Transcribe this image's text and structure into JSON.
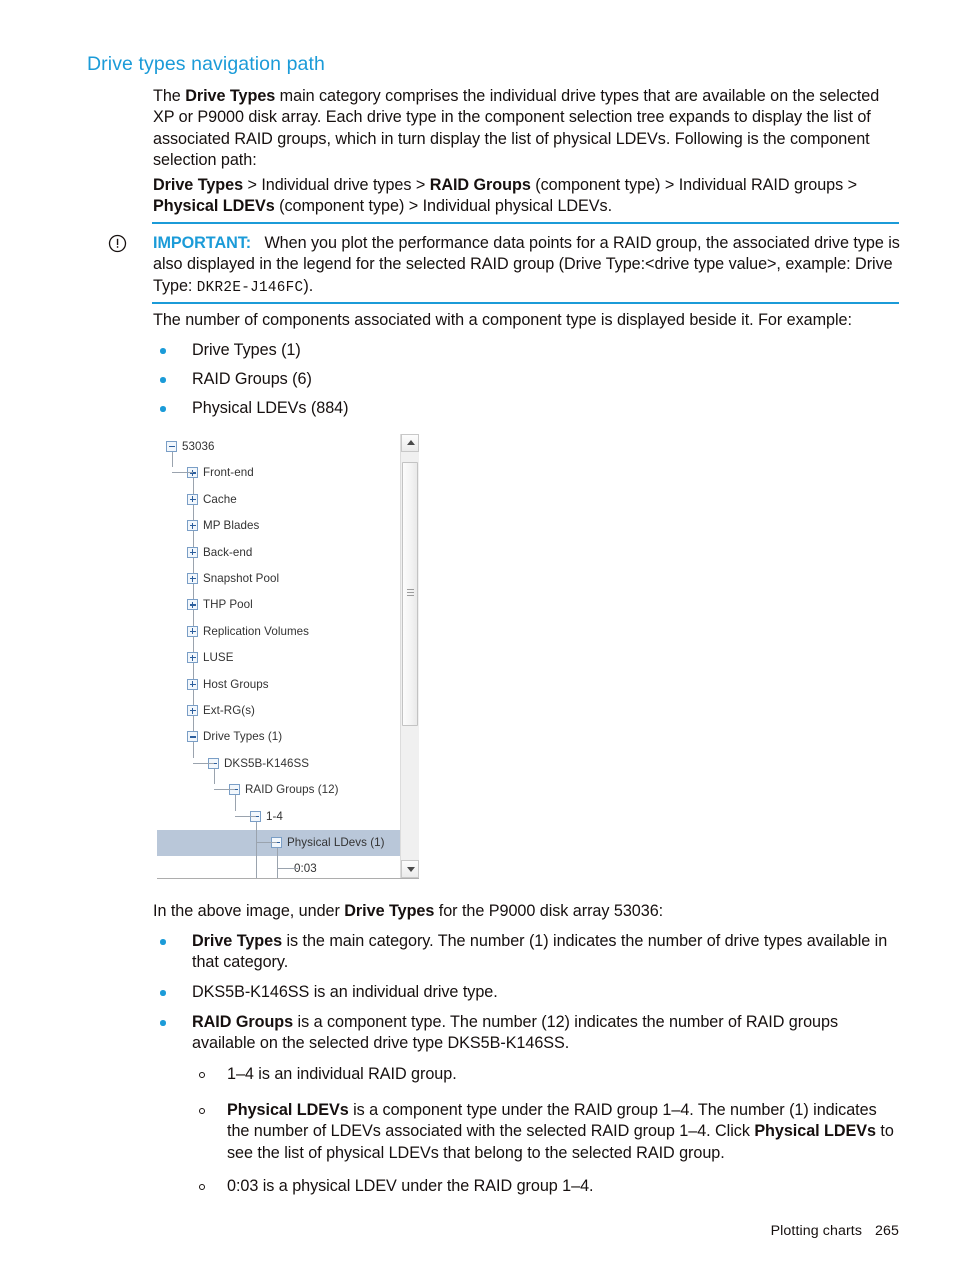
{
  "heading": "Drive types navigation path",
  "intro": {
    "line_prefix": "The ",
    "bold_1": "Drive Types",
    "rest": " main category comprises the individual drive types that are available on the selected XP or P9000 disk array. Each drive type in the component selection tree expands to display the list of associated RAID groups, which in turn display the list of physical LDEVs. Following is the component selection path:"
  },
  "path": {
    "seg1_bold": "Drive Types",
    "seg2": " > Individual drive types > ",
    "seg3_bold": "RAID Groups",
    "seg4": " (component type) > Individual RAID groups > ",
    "seg5_bold": "Physical LDEVs",
    "seg6": " (component type) > Individual physical LDEVs."
  },
  "important": {
    "icon": "exclamation-circle-icon",
    "label": "IMPORTANT:",
    "text_before_mono": "When you plot the performance data points for a RAID group, the associated drive type is also displayed in the legend for the selected RAID group (Drive Type:<drive type value>, example: Drive Type: ",
    "mono_value": "DKR2E-J146FC",
    "text_after_mono": ")."
  },
  "count_intro": "The number of components associated with a component type is displayed beside it. For example:",
  "count_bullets": [
    "Drive Types (1)",
    "RAID Groups (6)",
    "Physical LDEVs (884)"
  ],
  "tree": {
    "selected_row_index": 15,
    "rows": [
      {
        "label": "53036",
        "state": "minus",
        "depth": 0
      },
      {
        "label": "Front-end",
        "state": "plus",
        "depth": 1
      },
      {
        "label": "Cache",
        "state": "plus",
        "depth": 1
      },
      {
        "label": "MP Blades",
        "state": "plus",
        "depth": 1
      },
      {
        "label": "Back-end",
        "state": "plus",
        "depth": 1
      },
      {
        "label": "Snapshot Pool",
        "state": "plus",
        "depth": 1
      },
      {
        "label": "THP Pool",
        "state": "plus",
        "depth": 1
      },
      {
        "label": "Replication Volumes",
        "state": "plus",
        "depth": 1
      },
      {
        "label": "LUSE",
        "state": "plus",
        "depth": 1
      },
      {
        "label": "Host Groups",
        "state": "plus",
        "depth": 1
      },
      {
        "label": "Ext-RG(s)",
        "state": "plus",
        "depth": 1
      },
      {
        "label": "Drive Types (1)",
        "state": "minus",
        "depth": 1
      },
      {
        "label": "DKS5B-K146SS",
        "state": "minus",
        "depth": 2
      },
      {
        "label": "RAID Groups (12)",
        "state": "minus",
        "depth": 3
      },
      {
        "label": "1-4",
        "state": "minus",
        "depth": 4
      },
      {
        "label": "Physical LDevs (1)",
        "state": "minus",
        "depth": 5
      },
      {
        "label": "0:03",
        "state": "none",
        "depth": 6
      }
    ],
    "scrollbar": {
      "up_arrow": "scroll-up-arrow-icon",
      "down_arrow": "scroll-down-arrow-icon"
    }
  },
  "explain": {
    "intro_a": "In the above image, under ",
    "intro_bold": "Drive Types",
    "intro_b": " for the P9000 disk array 53036:",
    "b1_bold": "Drive Types",
    "b1_text": " is the main category. The number (1) indicates the number of drive types available in that category.",
    "b2_text": "DKS5B-K146SS is an individual drive type.",
    "b3_bold": "RAID Groups",
    "b3_text": " is a component type. The number (12) indicates the number of RAID groups available on the selected drive type DKS5B-K146SS.",
    "s1_text": "1–4 is an individual RAID group.",
    "s2_bold_a": "Physical LDEVs",
    "s2_text_a": " is a component type under the RAID group 1–4. The number (1) indicates the number of LDEVs associated with the selected RAID group 1–4. Click ",
    "s2_bold_b": "Physical LDEVs",
    "s2_text_b": " to see the list of physical LDEVs that belong to the selected RAID group.",
    "s3_text": "0:03 is a physical LDEV under the RAID group 1–4."
  },
  "footer": {
    "chapter": "Plotting charts",
    "page": "265"
  },
  "colors": {
    "accent": "#1b9bd8",
    "text": "#16100f",
    "selection": "#b9c7d9"
  }
}
